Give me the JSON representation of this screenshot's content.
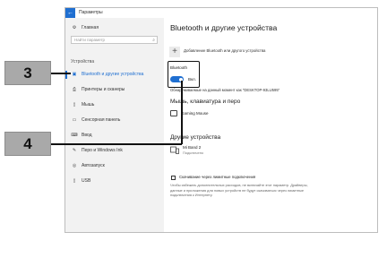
{
  "window": {
    "title": "Параметры",
    "back_icon": "arrow-left-icon",
    "accent_color": "#1f6fd1"
  },
  "sidebar": {
    "home_label": "Главная",
    "search_placeholder": "Найти параметр",
    "section_title": "Устройства",
    "items": [
      {
        "label": "Bluetooth и другие устройства",
        "icon": "bluetooth-devices-icon",
        "active": true
      },
      {
        "label": "Принтеры и сканеры",
        "icon": "printer-icon",
        "active": false
      },
      {
        "label": "Мышь",
        "icon": "mouse-icon",
        "active": false
      },
      {
        "label": "Сенсорная панель",
        "icon": "touchpad-icon",
        "active": false
      },
      {
        "label": "Ввод",
        "icon": "keyboard-icon",
        "active": false
      },
      {
        "label": "Перо и Windows Ink",
        "icon": "pen-icon",
        "active": false
      },
      {
        "label": "Автозапуск",
        "icon": "autoplay-icon",
        "active": false
      },
      {
        "label": "USB",
        "icon": "usb-icon",
        "active": false
      }
    ]
  },
  "main": {
    "title": "Bluetooth и другие устройства",
    "add_device_label": "Добавление Bluetooth или другого устройства",
    "bluetooth_label": "Bluetooth",
    "bluetooth_toggle_text": "Вкл.",
    "bluetooth_on": true,
    "discoverable_text": "Обнаруживаемые на данный момент как \"DESKTOP-93LU595\"",
    "mice_section_title": "Мышь, клавиатура и перо",
    "mouse_device_name": "Gaming Mouse",
    "other_section_title": "Другие устройства",
    "other_device_name": "Mi Band 2",
    "other_device_status": "Подключено",
    "metered_checkbox_label": "Скачивание через лимитные подключения",
    "metered_checked": false,
    "metered_description": "Чтобы избежать дополнительных расходов, не включайте этот параметр. Драйверы, данные и приложения для новых устройств не будут скачиваться через лимитные подключения к Интернету."
  },
  "callouts": {
    "step_3": "3",
    "step_4": "4"
  }
}
